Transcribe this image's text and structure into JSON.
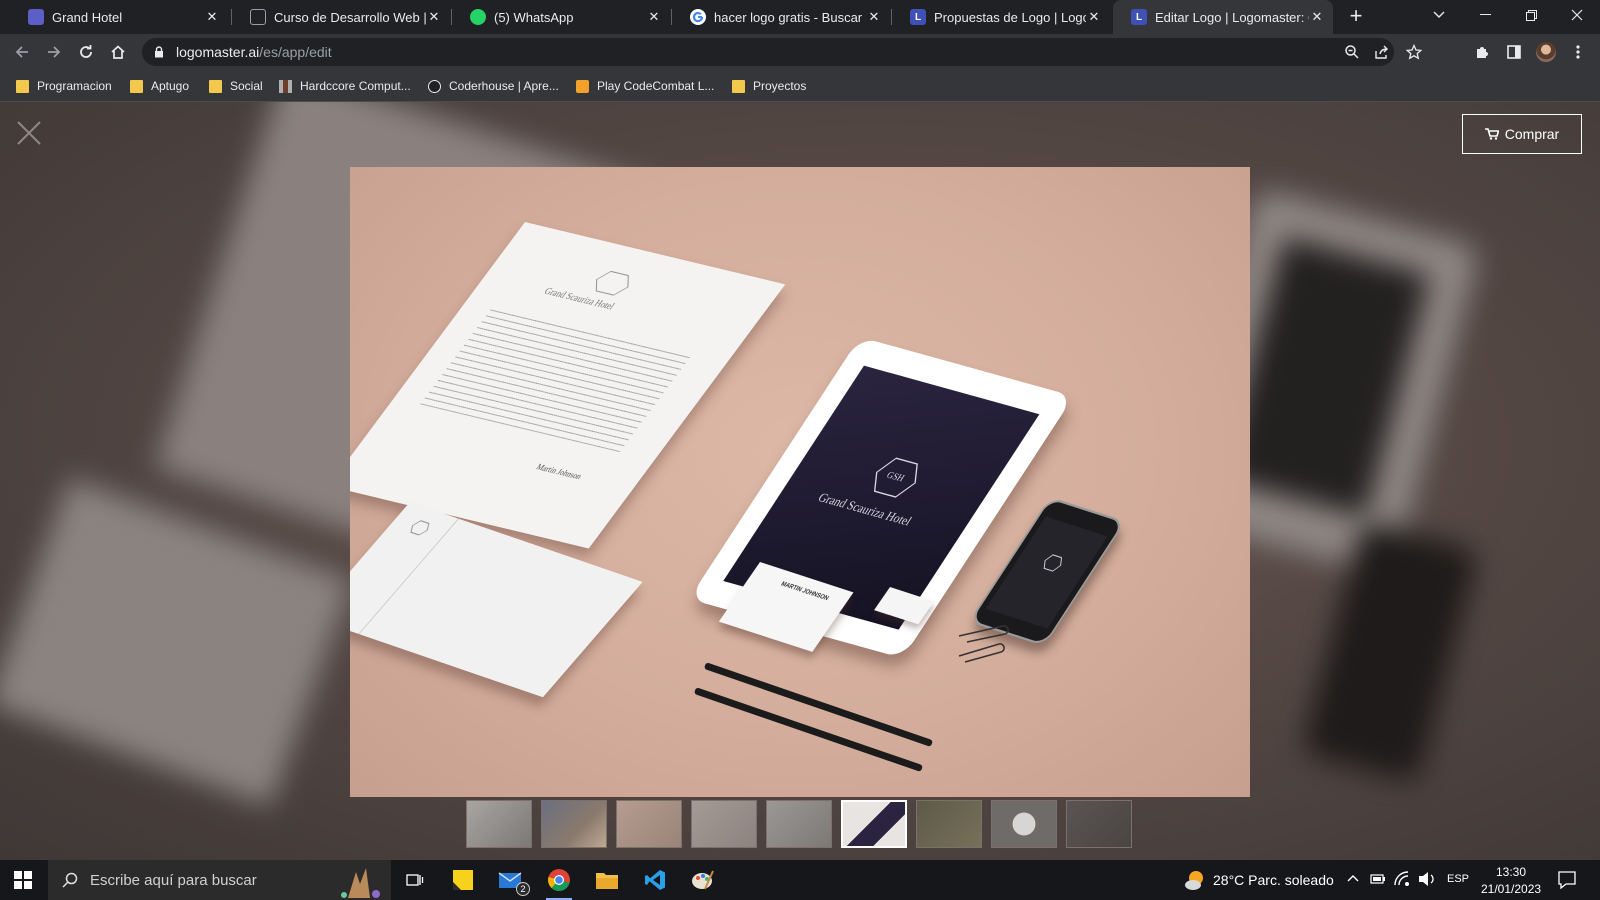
{
  "tabs": [
    {
      "title": "Grand Hotel",
      "icon": "calendar-favicon",
      "color": "#5b5fc7",
      "active": false
    },
    {
      "title": "Curso de Desarrollo Web | Pla",
      "icon": "coderhouse-favicon",
      "color": "#e8eaed",
      "active": false
    },
    {
      "title": "(5) WhatsApp",
      "icon": "whatsapp-favicon",
      "color": "#25d366",
      "active": false
    },
    {
      "title": "hacer logo gratis - Buscar cor",
      "icon": "google-favicon",
      "color": "#4285f4",
      "active": false
    },
    {
      "title": "Propuestas de Logo | Logoma",
      "icon": "logomaster-favicon",
      "favicon_letter": "L",
      "color": "#3f51b5",
      "active": false
    },
    {
      "title": "Editar Logo | Logomaster: On",
      "icon": "logomaster-favicon",
      "favicon_letter": "L",
      "color": "#3f51b5",
      "active": true
    }
  ],
  "address": {
    "domain": "logomaster.ai",
    "path": "/es/app/edit"
  },
  "bookmarks": [
    {
      "label": "Programacion",
      "icon": "folder-icon"
    },
    {
      "label": "Aptugo",
      "icon": "folder-icon"
    },
    {
      "label": "Social",
      "icon": "folder-icon"
    },
    {
      "label": "Hardccore Comput...",
      "icon": "hardcore-favicon"
    },
    {
      "label": "Coderhouse | Apre...",
      "icon": "coderhouse-favicon"
    },
    {
      "label": "Play CodeCombat L...",
      "icon": "codecombat-favicon"
    },
    {
      "label": "Proyectos",
      "icon": "folder-icon"
    }
  ],
  "page": {
    "buy_button": "Comprar",
    "mockup": {
      "hotel_name": "Grand Scauriza Hotel",
      "monogram": "GSH",
      "card_name": "MARTIN JOHNSON",
      "signature": "Martin Johnson"
    },
    "thumbnails_count": 9,
    "active_thumbnail": 6
  },
  "taskbar": {
    "search_placeholder": "Escribe aquí para buscar",
    "mail_badge": "2",
    "weather": "28°C  Parc. soleado",
    "language": "ESP",
    "time": "13:30",
    "date": "21/01/2023"
  },
  "colors": {
    "accent": "#8ab4f8",
    "tab_active": "#35363a",
    "frame": "#202124"
  }
}
